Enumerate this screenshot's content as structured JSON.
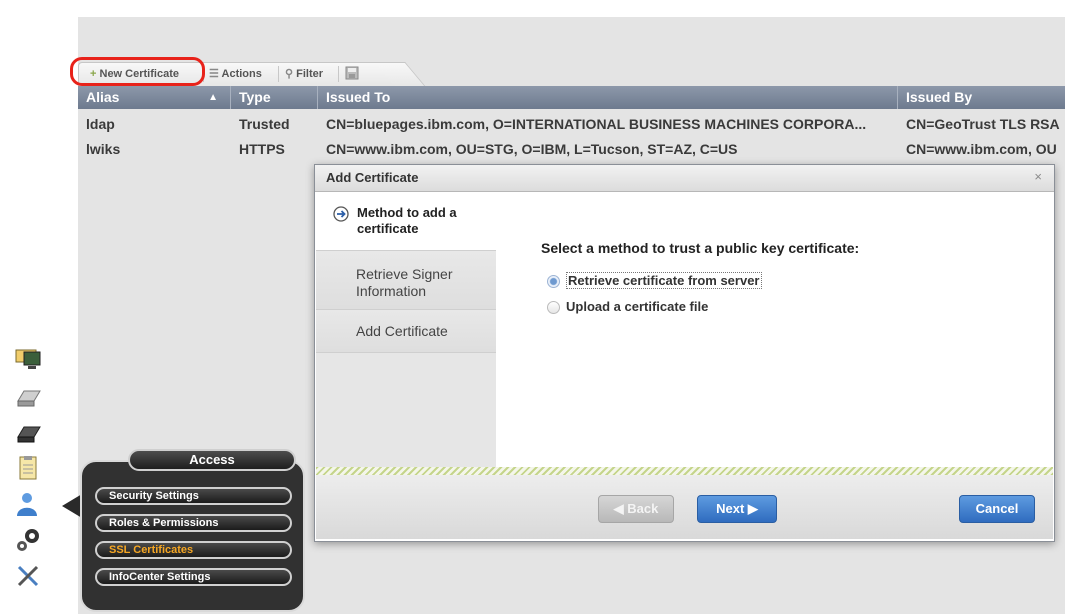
{
  "toolbar": {
    "new_certificate": "New Certificate",
    "actions": "Actions",
    "filter": "Filter"
  },
  "table": {
    "columns": {
      "alias": "Alias",
      "type": "Type",
      "issued_to": "Issued To",
      "issued_by": "Issued By"
    },
    "sort_indicator": "▲",
    "rows": [
      {
        "alias": "ldap",
        "type": "Trusted",
        "issued_to": "CN=bluepages.ibm.com, O=INTERNATIONAL BUSINESS MACHINES CORPORA...",
        "issued_by": "CN=GeoTrust TLS RSA"
      },
      {
        "alias": "lwiks",
        "type": "HTTPS",
        "issued_to": "CN=www.ibm.com, OU=STG, O=IBM, L=Tucson, ST=AZ, C=US",
        "issued_by": "CN=www.ibm.com, OU"
      }
    ]
  },
  "dialog": {
    "title": "Add Certificate",
    "close": "×",
    "steps": [
      {
        "label": "Method to add a certificate",
        "current": true
      },
      {
        "label": "Retrieve Signer Information",
        "current": false
      },
      {
        "label": "Add Certificate",
        "current": false
      }
    ],
    "prompt": "Select a method to trust a public key certificate:",
    "options": [
      {
        "label": "Retrieve certificate from server",
        "selected": true
      },
      {
        "label": "Upload a certificate file",
        "selected": false
      }
    ],
    "buttons": {
      "back": "◀ Back",
      "next": "Next ▶",
      "cancel": "Cancel"
    }
  },
  "access_menu": {
    "title": "Access",
    "items": [
      {
        "label": "Security Settings",
        "active": false
      },
      {
        "label": "Roles & Permissions",
        "active": false
      },
      {
        "label": "SSL Certificates",
        "active": true
      },
      {
        "label": "InfoCenter Settings",
        "active": false
      }
    ]
  },
  "colors": {
    "header_bg": "#7a8699",
    "highlight_ring": "#e8221a",
    "primary_button": "#3f82cf",
    "active_menu_text": "#f5a623",
    "stripe": "#c5d58b"
  },
  "sidebar_icons": [
    "monitor-icon",
    "drive-icon",
    "tape-drive-icon",
    "clipboard-icon",
    "user-icon",
    "gears-icon",
    "tools-icon"
  ]
}
